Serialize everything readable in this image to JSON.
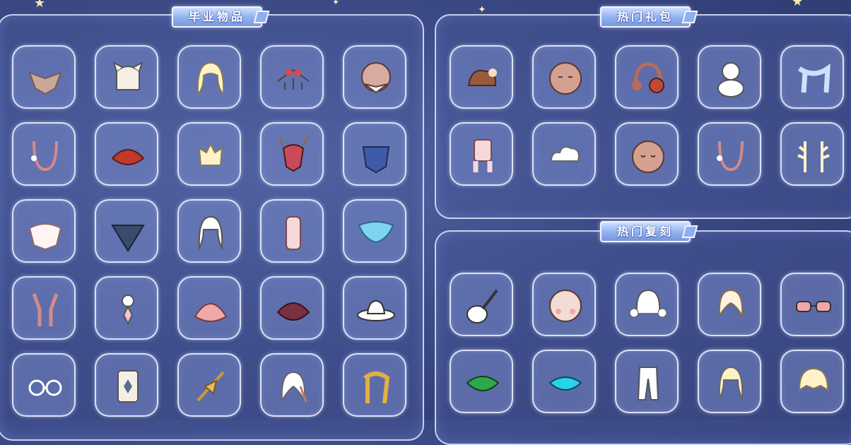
{
  "sections": {
    "graduation": {
      "title": "毕业物品"
    },
    "hot_packs": {
      "title": "热门礼包"
    },
    "hot_reprint": {
      "title": "热门复刻"
    }
  },
  "graduation_items": [
    "winged-cape-icon",
    "horned-hair-icon",
    "long-blonde-hair-icon",
    "ornament-headdress-icon",
    "masked-head-icon",
    "pink-necklace-icon",
    "red-cape-icon",
    "blonde-bun-hair-icon",
    "horned-mask-icon",
    "blue-robe-icon",
    "white-cape-icon",
    "dark-layered-cape-icon",
    "white-hair-icon",
    "pink-outfit-icon",
    "blue-bow-icon",
    "pink-scarf-icon",
    "pendant-accessory-icon",
    "pink-shell-cape-icon",
    "maroon-cape-icon",
    "cowboy-hat-icon",
    "round-glasses-icon",
    "emblem-badge-icon",
    "golden-staff-icon",
    "feather-hair-icon",
    "golden-scarf-icon"
  ],
  "hot_pack_items": [
    "squirrel-icon",
    "round-face-icon",
    "red-headphones-icon",
    "snowman-icon",
    "blue-scarf-icon",
    "pink-pajama-icon",
    "white-cloud-icon",
    "sleepy-face-icon",
    "pink-necklace-icon",
    "golden-antlers-icon"
  ],
  "reprint_items": [
    "ukulele-icon",
    "blushing-face-icon",
    "white-pigtail-hair-icon",
    "ponytail-hair-icon",
    "sunglasses-icon",
    "green-cape-icon",
    "cyan-cape-icon",
    "white-pants-icon",
    "wavy-hair-icon",
    "blonde-bob-hair-icon"
  ],
  "colors": {
    "background": "#3c4a86",
    "panel_border": "#e1e8ff",
    "slot_fill": "#8294d2",
    "title_banner": "#8fb0f0"
  }
}
